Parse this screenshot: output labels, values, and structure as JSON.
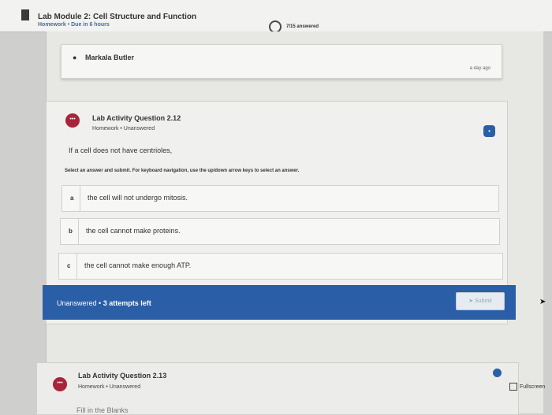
{
  "header": {
    "title": "Lab Module 2: Cell Structure and Function",
    "subtitle": "Homework • Due in 6 hours",
    "progress": "7/15 answered"
  },
  "author": {
    "name": "Markala Butler",
    "time": "a day ago"
  },
  "question": {
    "title": "Lab Activity Question 2.12",
    "meta": "Homework • Unanswered",
    "prompt": "If a cell does not have centrioles,",
    "instruction": "Select an answer and submit. For keyboard navigation, use the up/down arrow keys to select an answer.",
    "answers": [
      {
        "letter": "a",
        "text": "the cell will not undergo mitosis."
      },
      {
        "letter": "b",
        "text": "the cell cannot make proteins."
      },
      {
        "letter": "c",
        "text": "the cell cannot make enough ATP."
      }
    ],
    "status": "Unanswered",
    "attempts": "3 attempts left",
    "submit": "Submit"
  },
  "next_question": {
    "title": "Lab Activity Question 2.13",
    "meta": "Homework • Unanswered",
    "partial": "Fill in the Blanks"
  },
  "fullscreen": "Fullscreen",
  "icons": {
    "avatar": "ellipsis",
    "user": "person-icon"
  },
  "colors": {
    "accent": "#2a5fa8",
    "avatar": "#a8243a"
  }
}
